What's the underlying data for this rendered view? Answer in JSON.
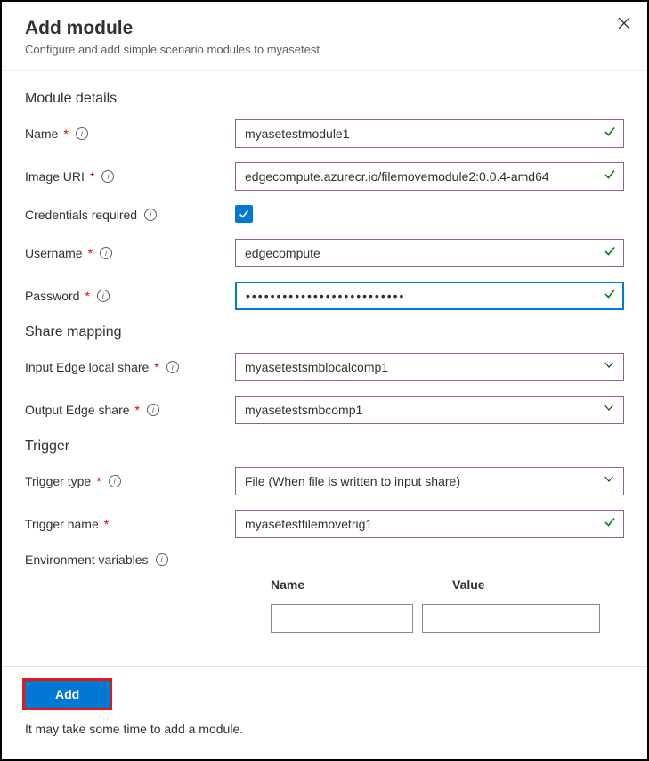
{
  "header": {
    "title": "Add module",
    "subtitle": "Configure and add simple scenario modules to myasetest"
  },
  "sections": {
    "module_details": "Module details",
    "share_mapping": "Share mapping",
    "trigger": "Trigger"
  },
  "labels": {
    "name": "Name",
    "image_uri": "Image URI",
    "credentials_required": "Credentials required",
    "username": "Username",
    "password": "Password",
    "input_share": "Input Edge local share",
    "output_share": "Output Edge share",
    "trigger_type": "Trigger type",
    "trigger_name": "Trigger name",
    "env_vars": "Environment variables"
  },
  "values": {
    "name": "myasetestmodule1",
    "image_uri": "edgecompute.azurecr.io/filemovemodule2:0.0.4-amd64",
    "credentials_required": true,
    "username": "edgecompute",
    "password": "••••••••••••••••••••••••••",
    "input_share": "myasetestsmblocalcomp1",
    "output_share": "myasetestsmbcomp1",
    "trigger_type": "File (When file is written to input share)",
    "trigger_name": "myasetestfilemovetrig1"
  },
  "env_table": {
    "col_name": "Name",
    "col_value": "Value"
  },
  "footer": {
    "add": "Add",
    "note": "It may take some time to add a module."
  }
}
